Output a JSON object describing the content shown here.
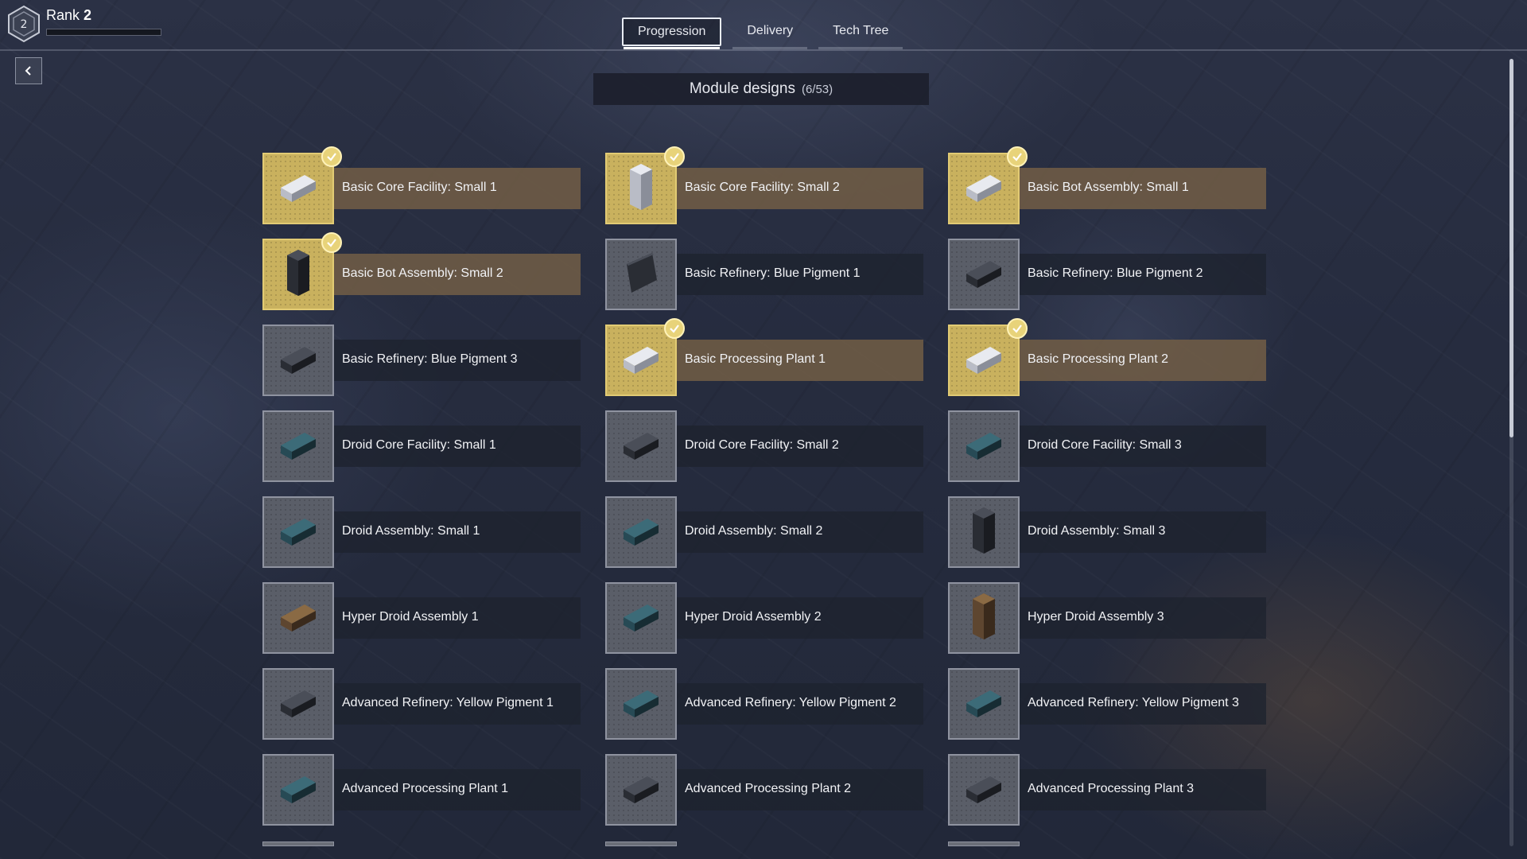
{
  "rank": {
    "label": "Rank",
    "value": "2",
    "badge": "2",
    "progress": 0.0
  },
  "tabs": [
    {
      "label": "Progression",
      "active": true
    },
    {
      "label": "Delivery",
      "active": false
    },
    {
      "label": "Tech Tree",
      "active": false
    }
  ],
  "section": {
    "title": "Module designs",
    "count": "(6/53)"
  },
  "modules": [
    {
      "label": "Basic Core Facility: Small 1",
      "unlocked": true,
      "icon": "light-block-icon"
    },
    {
      "label": "Basic Core Facility: Small 2",
      "unlocked": true,
      "icon": "light-tower-icon"
    },
    {
      "label": "Basic Bot Assembly: Small 1",
      "unlocked": true,
      "icon": "light-block-icon"
    },
    {
      "label": "Basic Bot Assembly: Small 2",
      "unlocked": true,
      "icon": "dark-tower-icon"
    },
    {
      "label": "Basic Refinery: Blue Pigment 1",
      "unlocked": false,
      "icon": "dark-slab-icon"
    },
    {
      "label": "Basic Refinery: Blue Pigment 2",
      "unlocked": false,
      "icon": "dark-block-icon"
    },
    {
      "label": "Basic Refinery: Blue Pigment 3",
      "unlocked": false,
      "icon": "dark-block-icon"
    },
    {
      "label": "Basic Processing Plant 1",
      "unlocked": true,
      "icon": "light-block-icon"
    },
    {
      "label": "Basic Processing Plant 2",
      "unlocked": true,
      "icon": "light-block-icon"
    },
    {
      "label": "Droid Core Facility: Small 1",
      "unlocked": false,
      "icon": "teal-block-icon"
    },
    {
      "label": "Droid Core Facility: Small 2",
      "unlocked": false,
      "icon": "dark-block-icon"
    },
    {
      "label": "Droid Core Facility: Small 3",
      "unlocked": false,
      "icon": "teal-block-icon"
    },
    {
      "label": "Droid Assembly: Small 1",
      "unlocked": false,
      "icon": "teal-block-icon"
    },
    {
      "label": "Droid Assembly: Small 2",
      "unlocked": false,
      "icon": "teal-block-icon"
    },
    {
      "label": "Droid Assembly: Small 3",
      "unlocked": false,
      "icon": "dark-tower-icon"
    },
    {
      "label": "Hyper Droid Assembly 1",
      "unlocked": false,
      "icon": "brown-block-icon"
    },
    {
      "label": "Hyper Droid Assembly 2",
      "unlocked": false,
      "icon": "teal-block-icon"
    },
    {
      "label": "Hyper Droid Assembly 3",
      "unlocked": false,
      "icon": "brown-tower-icon"
    },
    {
      "label": "Advanced Refinery: Yellow Pigment 1",
      "unlocked": false,
      "icon": "dark-block-icon"
    },
    {
      "label": "Advanced Refinery: Yellow Pigment 2",
      "unlocked": false,
      "icon": "teal-block-icon"
    },
    {
      "label": "Advanced Refinery: Yellow Pigment 3",
      "unlocked": false,
      "icon": "teal-block-icon"
    },
    {
      "label": "Advanced Processing Plant 1",
      "unlocked": false,
      "icon": "teal-block-icon"
    },
    {
      "label": "Advanced Processing Plant 2",
      "unlocked": false,
      "icon": "dark-block-icon"
    },
    {
      "label": "Advanced Processing Plant 3",
      "unlocked": false,
      "icon": "dark-block-icon"
    }
  ],
  "colors": {
    "unlocked_tile": "#c9b15e",
    "unlocked_bar": "#705c46",
    "locked_tile": "#5a5e68",
    "locked_bar": "#1e222e",
    "check_badge": "#e8d37a"
  }
}
